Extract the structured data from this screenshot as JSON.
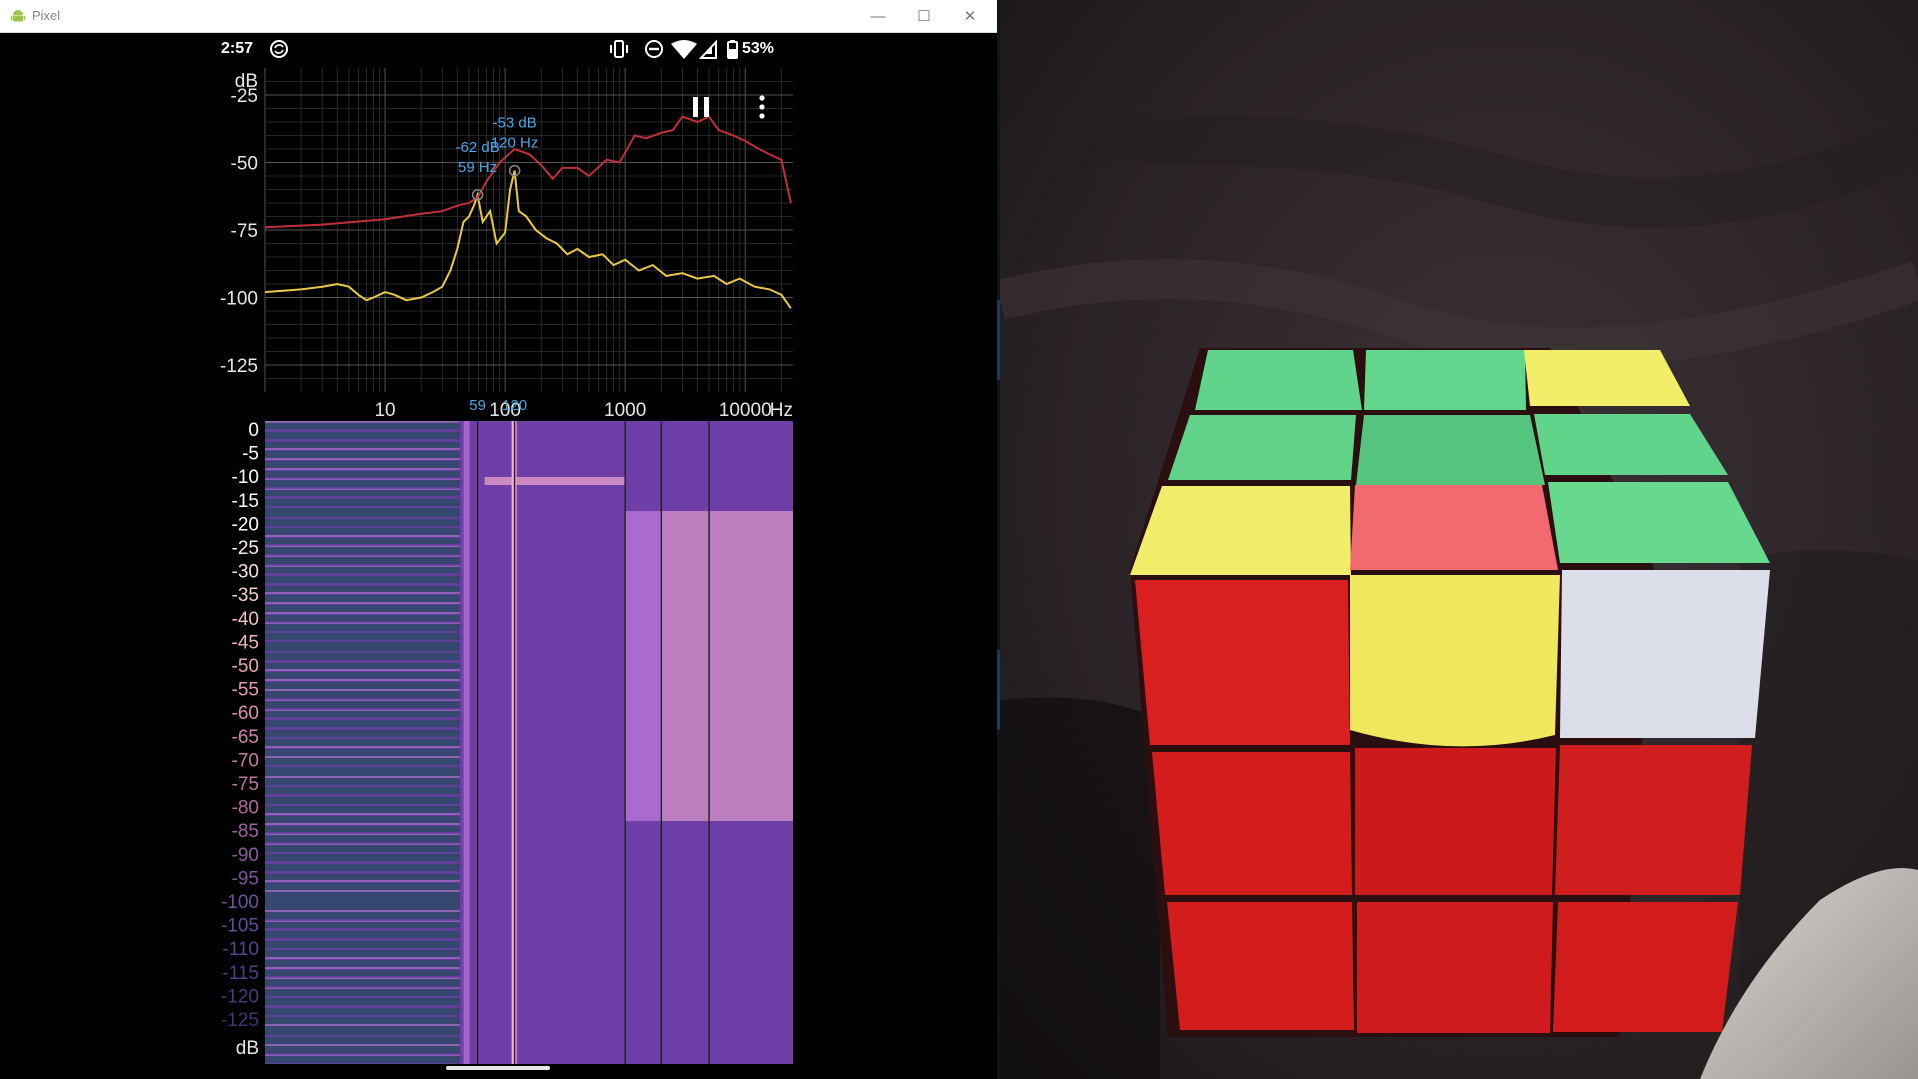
{
  "window": {
    "title": "Pixel",
    "controls": {
      "minimize": "—",
      "maximize": "☐",
      "close": "✕"
    },
    "colors": {
      "titlebar": "#ffffff",
      "android_green": "#9fc44b"
    }
  },
  "status_bar": {
    "time": "2:57",
    "battery_percent": "53%",
    "icons": [
      "sync-icon",
      "vibrate-icon",
      "do-not-disturb-icon",
      "wifi-icon",
      "cell-signal-icon",
      "battery-icon"
    ]
  },
  "analyzer": {
    "controls": {
      "pause_icon": "pause-icon",
      "menu_icon": "more-vert-icon"
    },
    "chart_data": [
      {
        "type": "line",
        "xscale": "log",
        "xlim": [
          1,
          25000
        ],
        "ylim": [
          -135,
          -15
        ],
        "yticks": [
          -25,
          -50,
          -75,
          -100,
          -125
        ],
        "ytick_labels": [
          "-25",
          "-50",
          "-75",
          "-100",
          "-125"
        ],
        "ylabel": "dB",
        "xticks": [
          10,
          100,
          1000,
          10000
        ],
        "xtick_labels": [
          "10",
          "100",
          "1000",
          "10000"
        ],
        "xunit": "Hz",
        "x_markers": [
          {
            "x": 59,
            "label": "59"
          },
          {
            "x": 120,
            "label": "120"
          }
        ],
        "grid": true,
        "series": [
          {
            "color": "#e8c84a",
            "x": [
              1,
              2,
              3,
              4,
              5,
              6,
              7,
              8,
              10,
              12,
              15,
              20,
              25,
              30,
              35,
              40,
              45,
              50,
              55,
              59,
              65,
              75,
              85,
              100,
              110,
              120,
              130,
              150,
              180,
              220,
              270,
              330,
              400,
              500,
              650,
              800,
              1000,
              1300,
              1700,
              2200,
              3000,
              4000,
              5500,
              7000,
              9000,
              12000,
              16000,
              20000,
              24000
            ],
            "y": [
              -98,
              -97,
              -96,
              -95,
              -96,
              -99,
              -101,
              -100,
              -98,
              -99,
              -101,
              -100,
              -98,
              -96,
              -90,
              -82,
              -72,
              -70,
              -66,
              -62,
              -72,
              -68,
              -80,
              -76,
              -60,
              -53,
              -68,
              -70,
              -75,
              -78,
              -80,
              -84,
              -82,
              -85,
              -84,
              -88,
              -86,
              -90,
              -88,
              -92,
              -91,
              -93,
              -92,
              -95,
              -93,
              -96,
              -97,
              -99,
              -104
            ]
          },
          {
            "color": "#c0303a",
            "x": [
              1,
              3,
              10,
              20,
              30,
              40,
              50,
              59,
              70,
              90,
              120,
              160,
              200,
              250,
              300,
              400,
              500,
              700,
              900,
              1200,
              1500,
              2000,
              2500,
              3000,
              4000,
              5000,
              6000,
              8000,
              10000,
              13000,
              16000,
              20000,
              24000
            ],
            "y": [
              -74,
              -73,
              -71,
              -69,
              -68,
              -66,
              -65,
              -63,
              -57,
              -50,
              -45,
              -47,
              -51,
              -56,
              -52,
              -52,
              -55,
              -49,
              -50,
              -40,
              -41,
              -39,
              -38,
              -33,
              -35,
              -33,
              -38,
              -40,
              -42,
              -45,
              -47,
              -49,
              -65
            ]
          }
        ],
        "annotations": [
          {
            "x": 59,
            "y": -62,
            "label_db": "-62 dB",
            "label_hz": "59 Hz"
          },
          {
            "x": 120,
            "y": -53,
            "label_db": "-53 dB",
            "label_hz": "120 Hz"
          }
        ]
      },
      {
        "type": "heatmap",
        "xscale": "log",
        "xlim": [
          1,
          25000
        ],
        "ylabel": "dB",
        "ytick_labels": [
          "0",
          "-5",
          "-10",
          "-15",
          "-20",
          "-25",
          "-30",
          "-35",
          "-40",
          "-45",
          "-50",
          "-55",
          "-60",
          "-65",
          "-70",
          "-75",
          "-80",
          "-85",
          "-90",
          "-95",
          "-100",
          "-105",
          "-110",
          "-115",
          "-120",
          "-125"
        ],
        "ytick_colors": [
          "#ffffff",
          "#ffffff",
          "#ffffff",
          "#ffffff",
          "#ffffff",
          "#fbeeed",
          "#f7dedf",
          "#f3cfd0",
          "#efc1c6",
          "#ebb4bd",
          "#e6a8b5",
          "#e19cad",
          "#d991a8",
          "#d086a6",
          "#c57ca4",
          "#b873a3",
          "#aa6aa3",
          "#9b63a2",
          "#8c5ca1",
          "#7d569f",
          "#6e519c",
          "#604c98",
          "#544791",
          "#4a4388",
          "#413e7e",
          "#3a3873"
        ],
        "colormap": [
          "#1a4d52",
          "#6f3fa8",
          "#b06fd3",
          "#f1a9cf",
          "#ffe7b0"
        ],
        "vertical_lines_hz": [
          59,
          120,
          1000,
          2000,
          5000
        ]
      }
    ]
  }
}
